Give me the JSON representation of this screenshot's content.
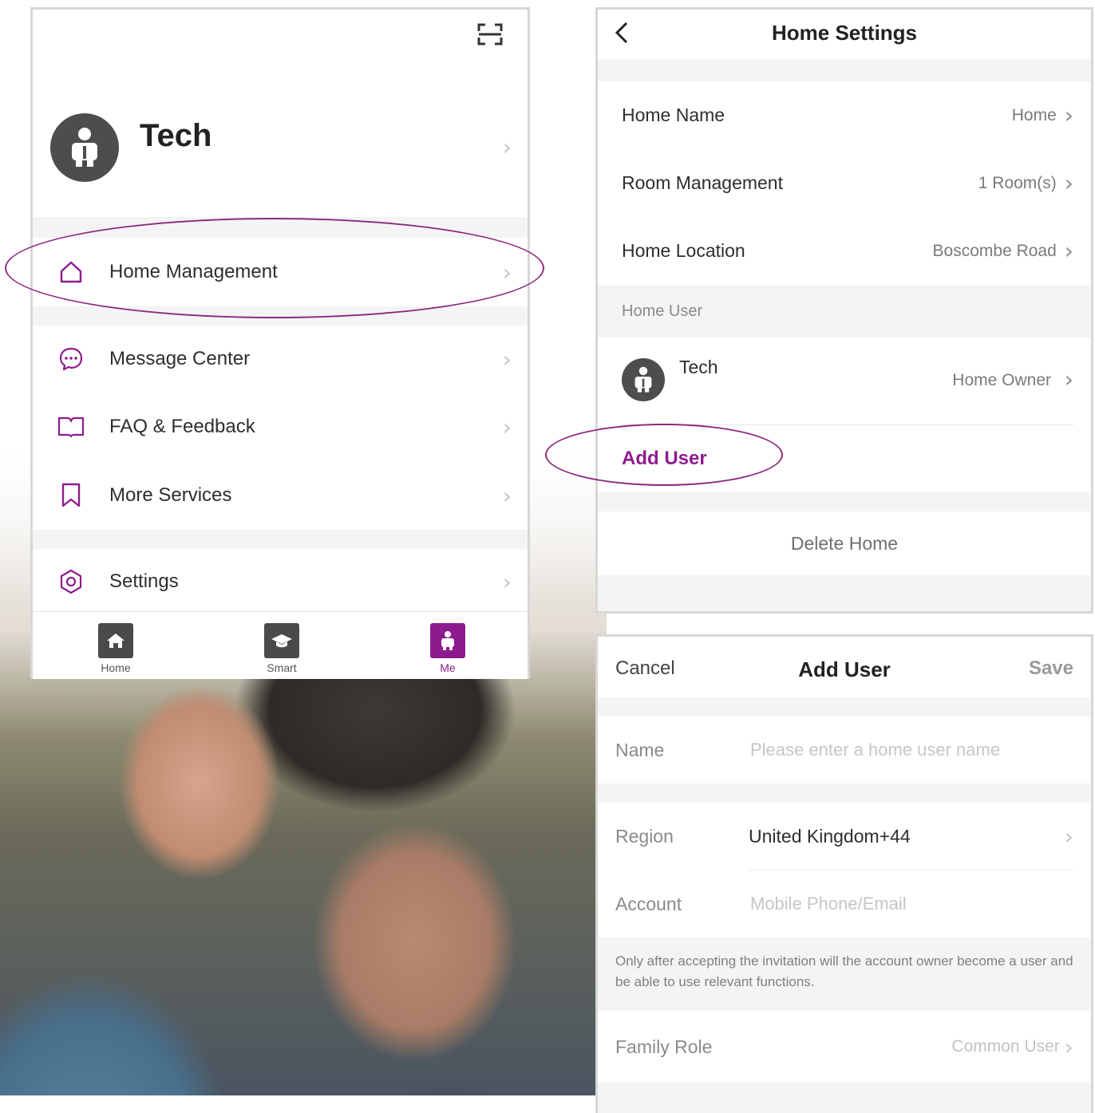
{
  "colors": {
    "accent": "#8e1b8e",
    "annotation": "#8d2a7f",
    "text": "#2e2e2e",
    "muted": "#8a8a8a"
  },
  "me_screen": {
    "profile": {
      "name": "Tech"
    },
    "menu": [
      {
        "label": "Home Management",
        "icon": "home-icon"
      },
      {
        "label": "Message Center",
        "icon": "chat-bubble-icon"
      },
      {
        "label": "FAQ & Feedback",
        "icon": "book-icon"
      },
      {
        "label": "More Services",
        "icon": "bookmark-icon"
      },
      {
        "label": "Settings",
        "icon": "gear-icon"
      }
    ],
    "tabs": [
      {
        "label": "Home",
        "icon": "house-icon"
      },
      {
        "label": "Smart",
        "icon": "graduation-cap-icon"
      },
      {
        "label": "Me",
        "icon": "person-icon",
        "active": true
      }
    ]
  },
  "home_settings": {
    "title": "Home Settings",
    "rows": [
      {
        "label": "Home Name",
        "value": "Home"
      },
      {
        "label": "Room Management",
        "value": "1 Room(s)"
      },
      {
        "label": "Home Location",
        "value": "Boscombe Road"
      }
    ],
    "section_header": "Home User",
    "user": {
      "name": "Tech",
      "role": "Home Owner"
    },
    "add_user": "Add User",
    "delete_home": "Delete Home"
  },
  "add_user": {
    "cancel": "Cancel",
    "title": "Add User",
    "save": "Save",
    "name_label": "Name",
    "name_placeholder": "Please enter a home user name",
    "region_label": "Region",
    "region_value": "United Kingdom+44",
    "account_label": "Account",
    "account_placeholder": "Mobile Phone/Email",
    "note": "Only after accepting the invitation will the account owner become a user and be able to use relevant functions.",
    "role_label": "Family Role",
    "role_value": "Common User"
  }
}
